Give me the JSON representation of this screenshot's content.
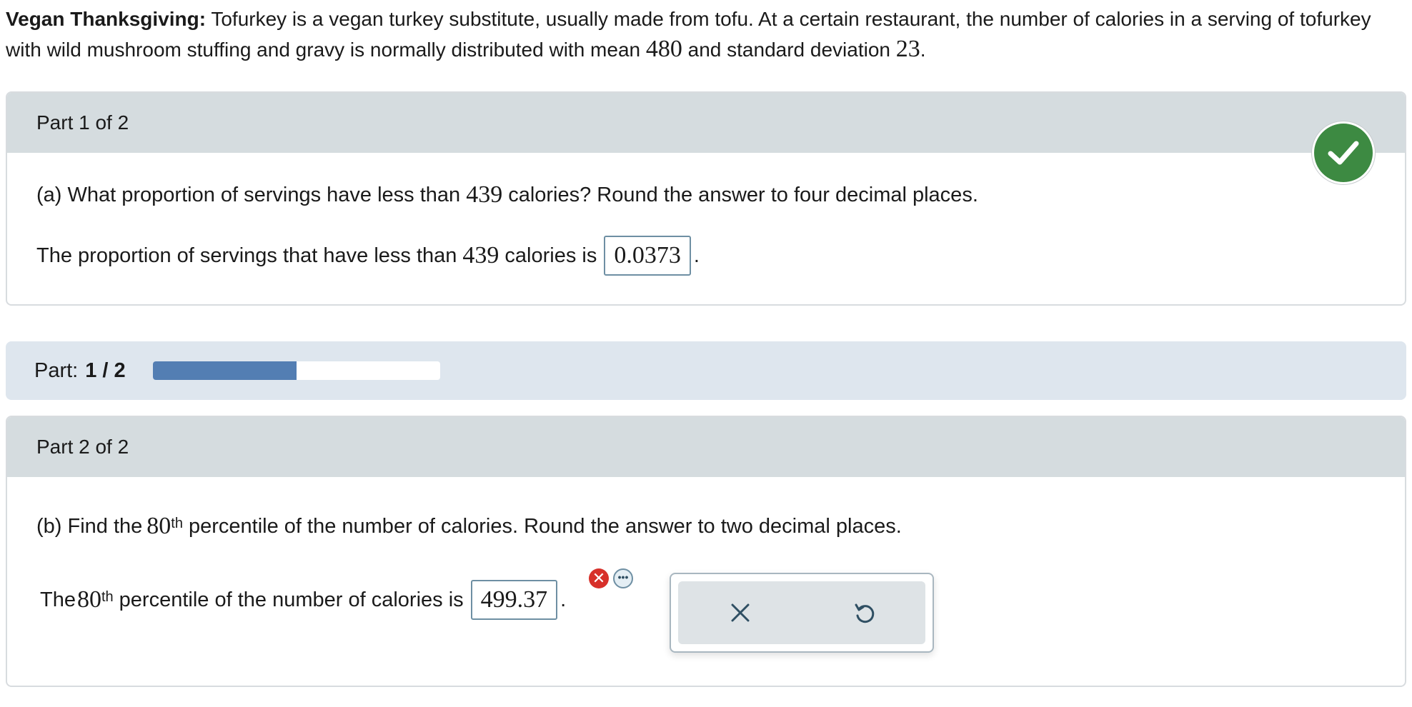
{
  "intro": {
    "bold_title": "Vegan Thanksgiving:",
    "text_a": " Tofurkey is a vegan turkey substitute, usually made from tofu. At a certain restaurant, the number of calories in a serving of tofurkey with wild mushroom stuffing and gravy is normally distributed with mean ",
    "mean": "480",
    "text_b": " and standard deviation ",
    "sd": "23",
    "text_c": "."
  },
  "part1": {
    "header": "Part 1 of 2",
    "question_a": "(a) What proportion of servings have less than ",
    "question_num": "439",
    "question_b": " calories? Round the answer to four decimal places.",
    "answer_a": "The proportion of servings that have less than ",
    "answer_num": "439",
    "answer_b": " calories is",
    "answer_value": "0.0373",
    "answer_end": ".",
    "status": "correct"
  },
  "progress": {
    "label": "Part:",
    "value": "1 / 2",
    "fraction": 0.5,
    "bar_color": "#537eb3"
  },
  "part2": {
    "header": "Part 2 of 2",
    "question_a": "(b) Find the ",
    "question_num": "80",
    "question_sup": "th",
    "question_b": " percentile of the number of calories. Round the answer to two decimal places.",
    "answer_a": "The ",
    "answer_num": "80",
    "answer_sup": "th",
    "answer_b": " percentile of the number of calories is",
    "answer_value": "499.37",
    "answer_end": ".",
    "status": "incorrect",
    "error_icon": "x-circle-icon",
    "more_icon": "ellipsis-icon"
  },
  "toolbar": {
    "clear_icon": "close-icon",
    "undo_icon": "undo-icon"
  },
  "colors": {
    "correct_green": "#3d8a42",
    "error_red": "#d7302a",
    "header_gray": "#d5dcdf",
    "progress_bg": "#dee6ee"
  }
}
